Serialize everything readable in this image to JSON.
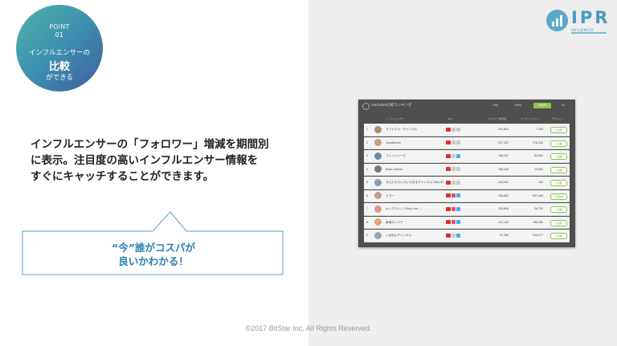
{
  "point": {
    "label": "POINT",
    "number": "01",
    "line1": "インフルエンサーの",
    "line2": "比較",
    "line3": "ができる"
  },
  "logo": {
    "text": "IPR",
    "subtext": "INFLUENCER"
  },
  "description": [
    "インフルエンサーの「フォロワー」増減を期間別",
    "に表示。注目度の高いインフルエンサー情報を",
    "すぐにキャッチすることができます。"
  ],
  "callout": {
    "line1": "“今”誰がコスパが",
    "line2": "良いかわかる！"
  },
  "screenshot": {
    "title": "YouTuber比較ランキング",
    "tabs": [
      {
        "label": "Day",
        "active": false
      },
      {
        "label": "Week",
        "active": false
      },
      {
        "label": "Month",
        "active": true
      },
      {
        "label": "All",
        "active": false
      }
    ],
    "columns": [
      "インフルエンサー",
      "SNS",
      "フォロワー数増減",
      "エンゲージメント",
      "アクション"
    ],
    "rows": [
      {
        "rank": "1",
        "name": "ラファエル・チャンネル",
        "followers": "241,804",
        "engagement": "7,395",
        "action": "+ 比較",
        "instagram": false,
        "twitter": false
      },
      {
        "rank": "2",
        "name": "Junskitchen",
        "followers": "217,157",
        "engagement": "176,243",
        "action": "+ 比較",
        "instagram": false,
        "twitter": false
      },
      {
        "rank": "3",
        "name": "フィッシャーズ",
        "followers": "198,107",
        "engagement": "83,552",
        "action": "+ 比較",
        "instagram": false,
        "twitter": true
      },
      {
        "rank": "4",
        "name": "Brian Games",
        "followers": "156,446",
        "engagement": "15,051",
        "action": "+ 比較",
        "instagram": false,
        "twitter": false
      },
      {
        "rank": "5",
        "name": "きんたろ.のいろいろあるチャンネル Sam, M...",
        "followers": "183,002",
        "engagement": "282",
        "action": "+ 比較",
        "instagram": false,
        "twitter": false
      },
      {
        "rank": "6",
        "name": "ミラー",
        "followers": "138,842",
        "engagement": "997,405",
        "action": "+ 比較中",
        "instagram": true,
        "twitter": true
      },
      {
        "rank": "7",
        "name": "キッズライン♡Kids Line♡...",
        "followers": "135,806",
        "engagement": "26,751",
        "action": "+ 比較",
        "instagram": true,
        "twitter": true
      },
      {
        "rank": "8",
        "name": "東海オンエア",
        "followers": "117,149",
        "engagement": "786,066",
        "action": "+ 比較",
        "instagram": true,
        "twitter": true
      },
      {
        "rank": "9",
        "name": "しばなんチャンネル",
        "followers": "97,290",
        "engagement": "410,077",
        "action": "+ 比較",
        "instagram": false,
        "twitter": true
      }
    ]
  },
  "copyright": "©2017 BitStar Inc. All Rights Reserved.",
  "colors": {
    "accent_blue": "#2b7fb5",
    "active_green": "#93c34e",
    "right_panel": "#eeeeee"
  }
}
